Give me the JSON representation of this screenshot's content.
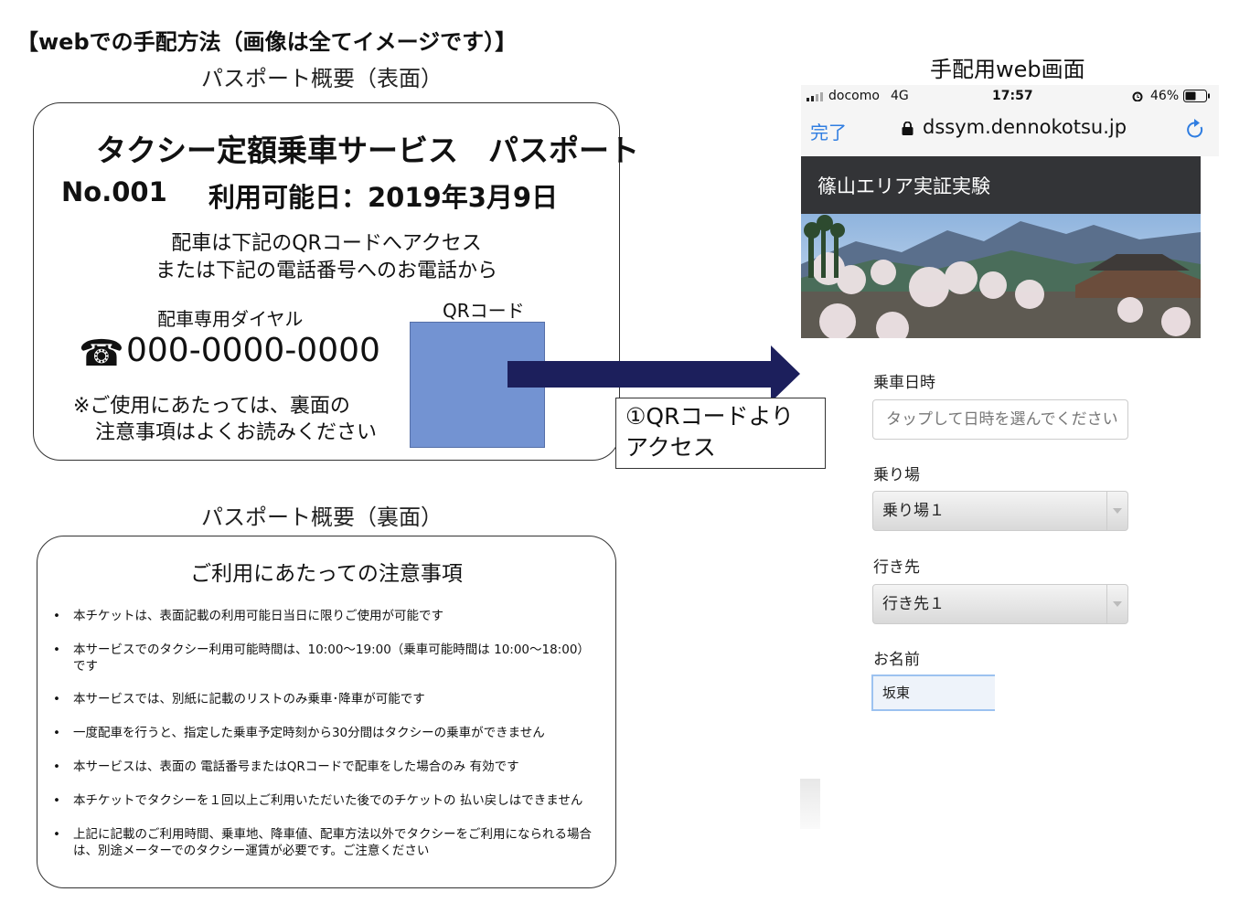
{
  "page_heading": "【webでの手配方法（画像は全てイメージです）】",
  "front": {
    "section_title": "パスポート概要（表面）",
    "title": "タクシー定額乗車サービス　パスポート",
    "number": "No.001",
    "date": "利用可能日：2019年3月9日",
    "access_line1": "配車は下記のQRコードへアクセス",
    "access_line2": "または下記の電話番号へのお電話から",
    "dial_label": "配車専用ダイヤル",
    "phone_icon": "☎",
    "phone_number": "000-0000-0000",
    "note_line1": "※ご使用にあたっては、裏面の",
    "note_line2": "注意事項はよくお読みください",
    "qr_label": "QRコード"
  },
  "callout": {
    "line1": "①QRコードより",
    "line2": "アクセス"
  },
  "back": {
    "section_title": "パスポート概要（裏面）",
    "heading": "ご利用にあたっての注意事項",
    "notes": [
      "本チケットは、表面記載の利用可能日当日に限りご使用が可能です",
      "本サービスでのタクシー利用可能時間は、10:00～19:00（乗車可能時間は 10:00～18:00）です",
      "本サービスでは、別紙に記載のリストのみ乗車･降車が可能です",
      "一度配車を行うと、指定した乗車予定時刻から30分間はタクシーの乗車ができません",
      "本サービスは、表面の 電話番号またはQRコードで配車をした場合のみ 有効です",
      "本チケットでタクシーを１回以上ご利用いただいた後でのチケットの 払い戻しはできません",
      "上記に記載のご利用時間、乗車地、降車値、配車方法以外でタクシーをご利用になられる場合は、別途メーターでのタクシー運賃が必要です。ご注意ください"
    ]
  },
  "phone_screen": {
    "section_title": "手配用web画面",
    "status": {
      "carrier": "docomo",
      "network": "4G",
      "time": "17:57",
      "alarm_icon": "alarm-icon",
      "battery": "46%"
    },
    "browser": {
      "done_label": "完了",
      "url": "dssym.dennokotsu.jp",
      "lock_icon": "lock-icon",
      "reload_icon": "reload-icon"
    },
    "app_title": "篠山エリア実証実験",
    "form": {
      "datetime_label": "乗車日時",
      "datetime_placeholder": "タップして日時を選んでください",
      "pickup_label": "乗り場",
      "pickup_value": "乗り場１",
      "destination_label": "行き先",
      "destination_value": "行き先１",
      "name_label": "お名前",
      "name_value": "坂東"
    }
  },
  "colors": {
    "arrow": "#1c1f5c",
    "qr_placeholder": "#7393d2",
    "ios_blue": "#2f7de1",
    "app_header": "#333437"
  }
}
